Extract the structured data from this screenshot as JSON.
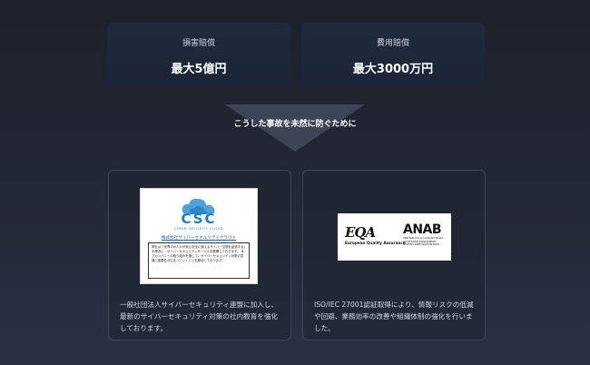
{
  "stats": [
    {
      "label": "損害賠償",
      "value": "最大5億円"
    },
    {
      "label": "費用賠償",
      "value": "最大3000万円"
    }
  ],
  "divider": {
    "text": "こうした事故を未然に防ぐために"
  },
  "features": [
    {
      "description": "一般社団法人サイバーセキュリティ連盟に加入し、最新のサイバーセキュリティ対策の社内教育を強化しております。",
      "image": {
        "logo": "CSC",
        "subtitle": "CYBER SECURITY CLOUD",
        "org": "株式会社サイバーセキュリティクラウド",
        "note": "弊社は「世界中の人々が安心安全に使えるサイバー空間を創造する」を理念に、サイバーセキュリティサービスを展開しております。 本アカンパニーの取り組みを通じて、サイバーセキュリティ対策の意識と重要性が広まっていくことを期待しております。"
      }
    },
    {
      "description": "ISO/IEC 27001認証取得により、情報リスクの低減や回避、業務効率の改善や組織体制の強化を行いました。",
      "image": {
        "logo_left": "EQA",
        "logo_left_sub": "European Quality Assurance",
        "logo_right": "ANAB",
        "logo_right_sub": "ANSI National Accreditation Board ACCREDITED MANAGEMENT SYSTEMS CERTIFICATION BODY"
      }
    }
  ],
  "colors": {
    "background": "#1f2430",
    "card": "#1d273a",
    "accent": "#1f7fc2"
  }
}
